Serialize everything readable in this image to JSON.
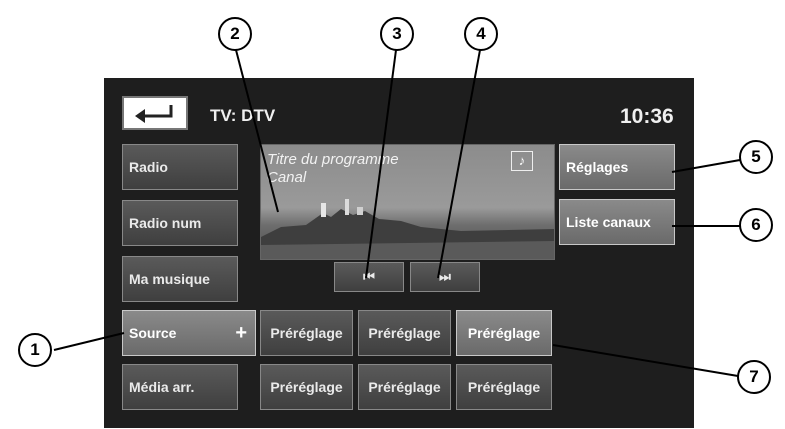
{
  "header": {
    "source_label": "TV:  DTV",
    "clock": "10:36"
  },
  "left_menu": [
    {
      "label": "Radio"
    },
    {
      "label": "Radio num"
    },
    {
      "label": "Ma musique"
    },
    {
      "label": "Source",
      "suffix": "+"
    },
    {
      "label": "Média arr."
    }
  ],
  "video": {
    "program_title": "Titre du programme",
    "channel": "Canal",
    "note_icon": "♪"
  },
  "transport": {
    "prev_icon": "⏮",
    "next_icon": "⏭"
  },
  "right_menu": {
    "settings": "Réglages",
    "channel_list": "Liste canaux"
  },
  "presets": {
    "row1": [
      "Préréglage",
      "Préréglage",
      "Préréglage"
    ],
    "row2": [
      "Préréglage",
      "Préréglage",
      "Préréglage"
    ]
  },
  "callouts": [
    "1",
    "2",
    "3",
    "4",
    "5",
    "6",
    "7"
  ],
  "colors": {
    "screen": "#1e1e1e",
    "button": "#4a4a4a",
    "highlight": "#7a7a7a"
  }
}
